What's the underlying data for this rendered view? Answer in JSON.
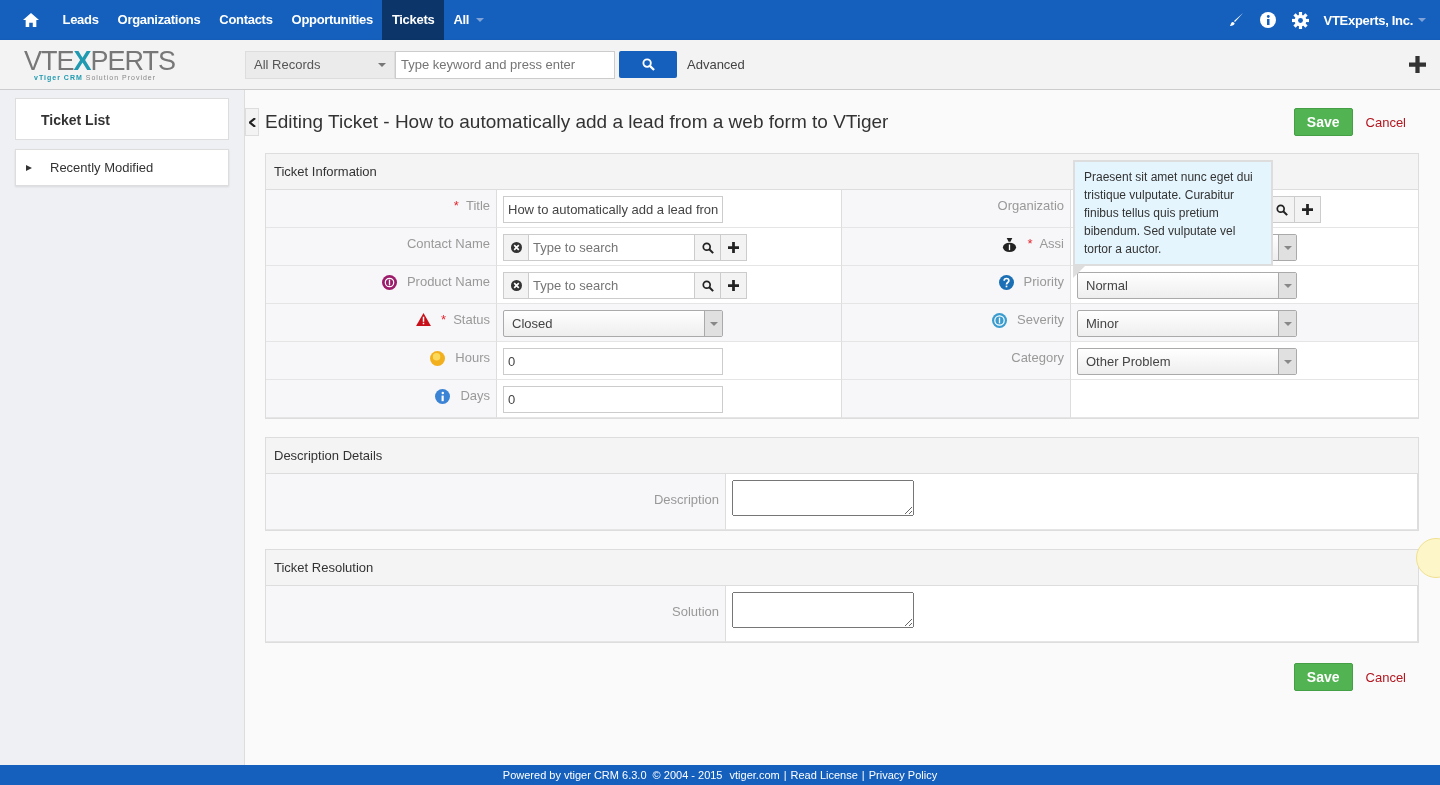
{
  "nav": {
    "items": [
      {
        "label": "Leads",
        "selected": false
      },
      {
        "label": "Organizations",
        "selected": false
      },
      {
        "label": "Contacts",
        "selected": false
      },
      {
        "label": "Opportunities",
        "selected": false
      },
      {
        "label": "Tickets",
        "selected": true
      },
      {
        "label": "All",
        "selected": false
      }
    ],
    "user": "VTExperts, Inc."
  },
  "logo": {
    "before": "VTE",
    "accent": "X",
    "after": "PERTS",
    "tagline_a": "vTiger",
    "tagline_b": "CRM",
    "tagline_c": "Solution Provider"
  },
  "search": {
    "scope": "All Records",
    "placeholder": "Type keyword and press enter",
    "advanced": "Advanced"
  },
  "sidebar": {
    "title": "Ticket List",
    "items": [
      {
        "label": "Recently Modified",
        "expanded": false
      }
    ]
  },
  "page": {
    "title": "Editing Ticket - How to automatically add a lead from a web form to VTiger",
    "save": "Save",
    "cancel": "Cancel",
    "save_bottom": "Save",
    "cancel_bottom": "Cancel"
  },
  "info": {
    "title": "Ticket Information",
    "rows": [
      [
        {
          "label": "Title",
          "marker": "*",
          "kind": "text",
          "value": "How to automatically add a lead fron"
        },
        {
          "label": "Organizatio",
          "kind": "reference-locked"
        }
      ],
      [
        {
          "label": "Contact Name",
          "kind": "reference",
          "placeholder": "Type to search"
        },
        {
          "label": "Assi",
          "marker": "*",
          "kind": "select"
        }
      ],
      [
        {
          "label": "Product Name",
          "kind": "reference",
          "placeholder": "Type to search"
        },
        {
          "label": "Priority",
          "kind": "select",
          "value": "Normal"
        }
      ],
      [
        {
          "label": "Status",
          "marker": "*",
          "kind": "select",
          "value": "Closed"
        },
        {
          "label": "Severity",
          "kind": "select",
          "value": "Minor"
        }
      ],
      [
        {
          "label": "Hours",
          "kind": "text",
          "value": "0"
        },
        {
          "label": "Category",
          "kind": "select",
          "value": "Other Problem"
        }
      ],
      [
        {
          "label": "Days",
          "kind": "text",
          "value": "0"
        },
        {
          "kind": "empty"
        }
      ]
    ]
  },
  "tooltip": "Praesent sit amet nunc eget dui tristique vulputate. Curabitur finibus tellus quis pretium bibendum. Sed vulputate vel tortor a auctor.",
  "text_sections": [
    {
      "title": "Description Details",
      "label": "Description"
    },
    {
      "title": "Ticket Resolution",
      "label": "Solution"
    }
  ],
  "footer": {
    "text": "Powered by vtiger CRM 6.3.0  © 2004 - 2015 ",
    "separator": "|",
    "links": [
      "vtiger.com",
      "Read License",
      "Privacy Policy"
    ]
  }
}
